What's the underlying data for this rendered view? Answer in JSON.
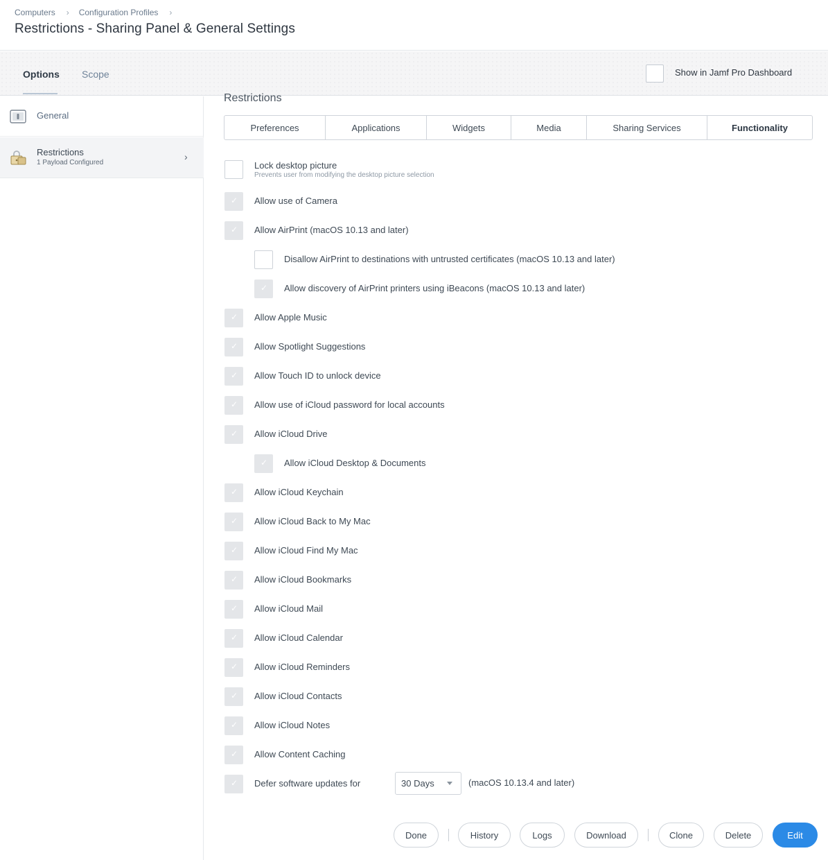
{
  "breadcrumb": {
    "items": [
      "Computers",
      "Configuration Profiles"
    ],
    "sep": "›"
  },
  "page_title": "Restrictions - Sharing Panel & General Settings",
  "tabs": {
    "options": "Options",
    "scope": "Scope"
  },
  "dashboard": {
    "label": "Show in Jamf Pro Dashboard",
    "checked": false
  },
  "sidebar": {
    "general": {
      "label": "General"
    },
    "restrictions": {
      "label": "Restrictions",
      "sub": "1 Payload Configured",
      "chevron": "›"
    }
  },
  "section_title": "Restrictions",
  "subtabs": [
    "Preferences",
    "Applications",
    "Widgets",
    "Media",
    "Sharing Services",
    "Functionality"
  ],
  "active_subtab": "Functionality",
  "options": {
    "lock_desktop": {
      "label": "Lock desktop picture",
      "desc": "Prevents user from modifying the desktop picture selection",
      "checked": false
    },
    "camera": {
      "label": "Allow use of Camera",
      "checked": true
    },
    "airprint": {
      "label": "Allow AirPrint (macOS 10.13 and later)",
      "checked": true
    },
    "airprint_untrusted": {
      "label": "Disallow AirPrint to destinations with untrusted certificates (macOS 10.13 and later)",
      "checked": false
    },
    "airprint_ibeacons": {
      "label": "Allow discovery of AirPrint printers using iBeacons (macOS 10.13 and later)",
      "checked": true
    },
    "apple_music": {
      "label": "Allow Apple Music",
      "checked": true
    },
    "spotlight": {
      "label": "Allow Spotlight Suggestions",
      "checked": true
    },
    "touch_id": {
      "label": "Allow Touch ID to unlock device",
      "checked": true
    },
    "icloud_password": {
      "label": "Allow use of iCloud password for local accounts",
      "checked": true
    },
    "icloud_drive": {
      "label": "Allow iCloud Drive",
      "checked": true
    },
    "icloud_desktop_docs": {
      "label": "Allow iCloud Desktop & Documents",
      "checked": true
    },
    "icloud_keychain": {
      "label": "Allow iCloud Keychain",
      "checked": true
    },
    "icloud_back_to_my_mac": {
      "label": "Allow iCloud Back to My Mac",
      "checked": true
    },
    "icloud_find_my_mac": {
      "label": "Allow iCloud Find My Mac",
      "checked": true
    },
    "icloud_bookmarks": {
      "label": "Allow iCloud Bookmarks",
      "checked": true
    },
    "icloud_mail": {
      "label": "Allow iCloud Mail",
      "checked": true
    },
    "icloud_calendar": {
      "label": "Allow iCloud Calendar",
      "checked": true
    },
    "icloud_reminders": {
      "label": "Allow iCloud Reminders",
      "checked": true
    },
    "icloud_contacts": {
      "label": "Allow iCloud Contacts",
      "checked": true
    },
    "icloud_notes": {
      "label": "Allow iCloud Notes",
      "checked": true
    },
    "content_caching": {
      "label": "Allow Content Caching",
      "checked": true
    },
    "defer_updates": {
      "label": "Defer software updates for",
      "checked": true,
      "select_value": "30 Days",
      "note": "(macOS 10.13.4 and later)"
    }
  },
  "footer": {
    "done": "Done",
    "history": "History",
    "logs": "Logs",
    "download": "Download",
    "clone": "Clone",
    "delete": "Delete",
    "edit": "Edit"
  },
  "colors": {
    "accent": "#2b8ae6",
    "checked_box": "#e4e6e9"
  }
}
